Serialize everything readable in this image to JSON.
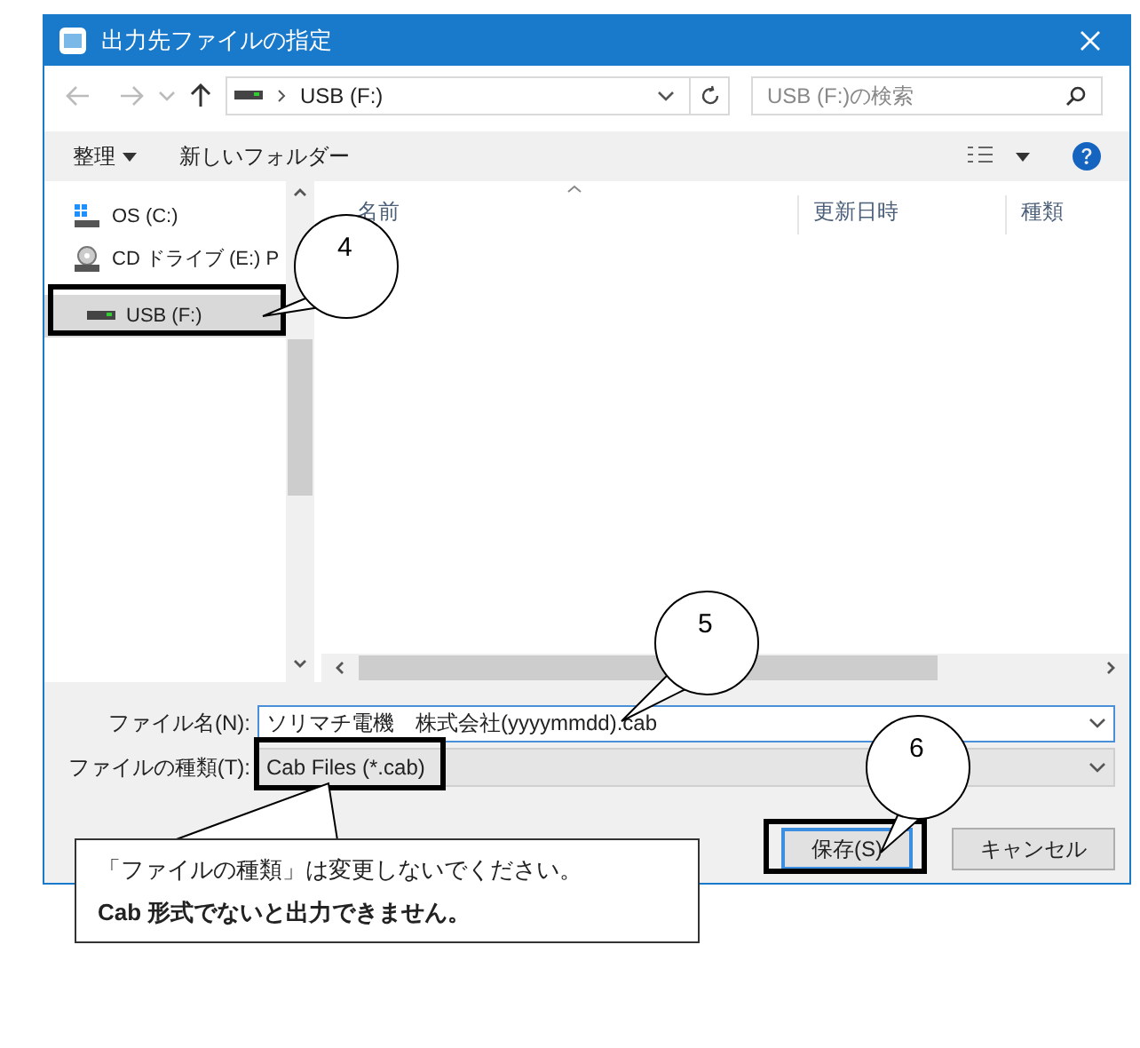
{
  "window": {
    "title": "出力先ファイルの指定"
  },
  "nav": {
    "path": "USB (F:)",
    "search_placeholder": "USB (F:)の検索"
  },
  "toolbar": {
    "organize": "整理",
    "new_folder": "新しいフォルダー"
  },
  "sidebar": {
    "items": [
      {
        "label": "OS (C:)",
        "kind": "os",
        "selected": false
      },
      {
        "label": "CD ドライブ (E:) P",
        "kind": "cd",
        "selected": false
      },
      {
        "label": "USB (F:)",
        "kind": "usb",
        "selected": true
      }
    ]
  },
  "file_list": {
    "columns": [
      "名前",
      "更新日時",
      "種類"
    ]
  },
  "form": {
    "filename_label": "ファイル名(N):",
    "filename_value": "ソリマチ電機　株式会社(yyyymmdd).cab",
    "type_label": "ファイルの種類(T):",
    "type_value": "Cab Files (*.cab)"
  },
  "buttons": [
    {
      "label": "保存(S)",
      "kind": "primary"
    },
    {
      "label": "キャンセル",
      "kind": "normal"
    }
  ],
  "callouts": [
    {
      "number": "4"
    },
    {
      "number": "5"
    },
    {
      "number": "6"
    }
  ],
  "note": {
    "lines": [
      {
        "text": "「ファイルの種類」は変更しないでください。",
        "emphasis": false
      },
      {
        "text": "Cab 形式でないと出力できません。",
        "emphasis": true
      }
    ]
  }
}
